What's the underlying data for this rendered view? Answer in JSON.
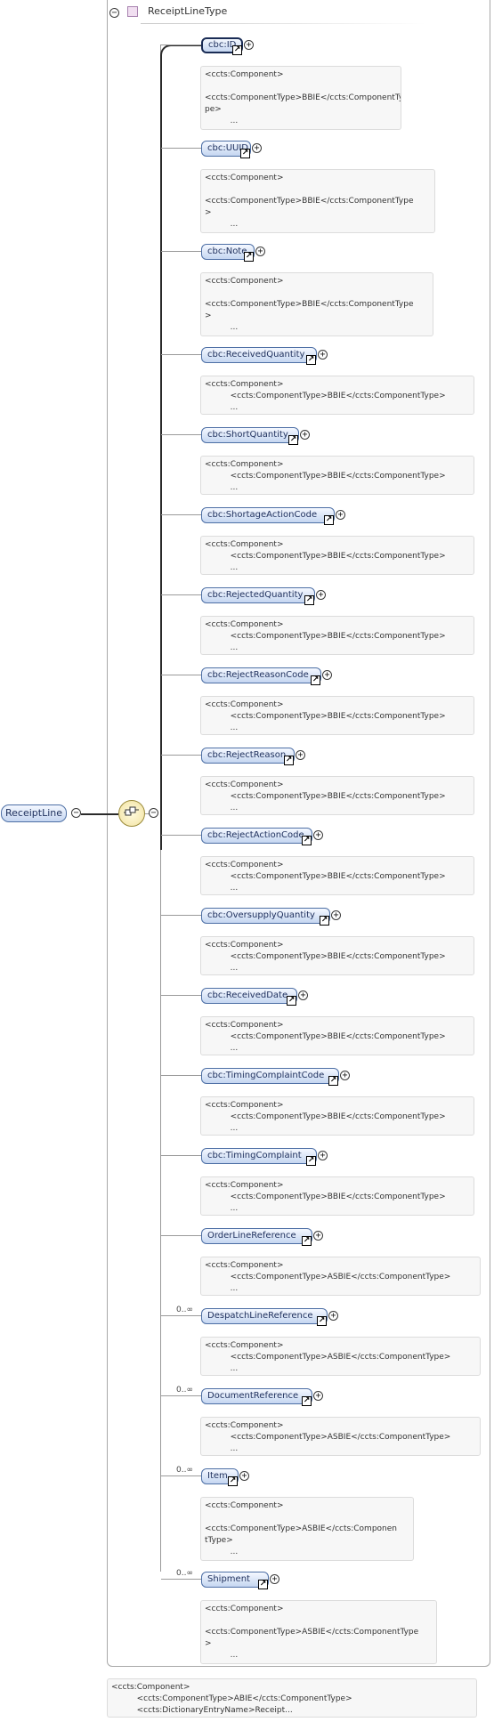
{
  "root_element": "ReceiptLine",
  "type_name": "ReceiptLineType",
  "elements": [
    {
      "name": "cbc:ID",
      "multiplicity": "",
      "annotation": "<ccts:Component>\n\n<ccts:ComponentType>BBIE</ccts:ComponentTy\npe>\n          ..."
    },
    {
      "name": "cbc:UUID",
      "multiplicity": "",
      "annotation": "<ccts:Component>\n\n<ccts:ComponentType>BBIE</ccts:ComponentType\n>\n          ..."
    },
    {
      "name": "cbc:Note",
      "multiplicity": "",
      "annotation": "<ccts:Component>\n\n<ccts:ComponentType>BBIE</ccts:ComponentType\n>\n          ..."
    },
    {
      "name": "cbc:ReceivedQuantity",
      "multiplicity": "",
      "annotation": "<ccts:Component>\n          <ccts:ComponentType>BBIE</ccts:ComponentType>\n          ..."
    },
    {
      "name": "cbc:ShortQuantity",
      "multiplicity": "",
      "annotation": "<ccts:Component>\n          <ccts:ComponentType>BBIE</ccts:ComponentType>\n          ..."
    },
    {
      "name": "cbc:ShortageActionCode",
      "multiplicity": "",
      "annotation": "<ccts:Component>\n          <ccts:ComponentType>BBIE</ccts:ComponentType>\n          ..."
    },
    {
      "name": "cbc:RejectedQuantity",
      "multiplicity": "",
      "annotation": "<ccts:Component>\n          <ccts:ComponentType>BBIE</ccts:ComponentType>\n          ..."
    },
    {
      "name": "cbc:RejectReasonCode",
      "multiplicity": "",
      "annotation": "<ccts:Component>\n          <ccts:ComponentType>BBIE</ccts:ComponentType>\n          ..."
    },
    {
      "name": "cbc:RejectReason",
      "multiplicity": "",
      "annotation": "<ccts:Component>\n          <ccts:ComponentType>BBIE</ccts:ComponentType>\n          ..."
    },
    {
      "name": "cbc:RejectActionCode",
      "multiplicity": "",
      "annotation": "<ccts:Component>\n          <ccts:ComponentType>BBIE</ccts:ComponentType>\n          ..."
    },
    {
      "name": "cbc:OversupplyQuantity",
      "multiplicity": "",
      "annotation": "<ccts:Component>\n          <ccts:ComponentType>BBIE</ccts:ComponentType>\n          ..."
    },
    {
      "name": "cbc:ReceivedDate",
      "multiplicity": "",
      "annotation": "<ccts:Component>\n          <ccts:ComponentType>BBIE</ccts:ComponentType>\n          ..."
    },
    {
      "name": "cbc:TimingComplaintCode",
      "multiplicity": "",
      "annotation": "<ccts:Component>\n          <ccts:ComponentType>BBIE</ccts:ComponentType>\n          ..."
    },
    {
      "name": "cbc:TimingComplaint",
      "multiplicity": "",
      "annotation": "<ccts:Component>\n          <ccts:ComponentType>BBIE</ccts:ComponentType>\n          ..."
    },
    {
      "name": "OrderLineReference",
      "multiplicity": "",
      "annotation": "<ccts:Component>\n          <ccts:ComponentType>ASBIE</ccts:ComponentType>\n          ..."
    },
    {
      "name": "DespatchLineReference",
      "multiplicity": "0..∞",
      "annotation": "<ccts:Component>\n          <ccts:ComponentType>ASBIE</ccts:ComponentType>\n          ..."
    },
    {
      "name": "DocumentReference",
      "multiplicity": "0..∞",
      "annotation": "<ccts:Component>\n          <ccts:ComponentType>ASBIE</ccts:ComponentType>\n          ..."
    },
    {
      "name": "Item",
      "multiplicity": "0..∞",
      "annotation": "<ccts:Component>\n\n<ccts:ComponentType>ASBIE</ccts:Componen\ntType>\n          ..."
    },
    {
      "name": "Shipment",
      "multiplicity": "0..∞",
      "annotation": "<ccts:Component>\n\n<ccts:ComponentType>ASBIE</ccts:ComponentType\n>\n          ..."
    }
  ],
  "type_annotation": "<ccts:Component>\n          <ccts:ComponentType>ABIE</ccts:ComponentType>\n          <ccts:DictionaryEntryName>Receipt...",
  "icons": {
    "collapse": "collapse-icon",
    "expand": "expand-icon",
    "link": "link-arrow-icon",
    "sequence": "sequence-compositor-icon",
    "type": "complex-type-icon"
  }
}
